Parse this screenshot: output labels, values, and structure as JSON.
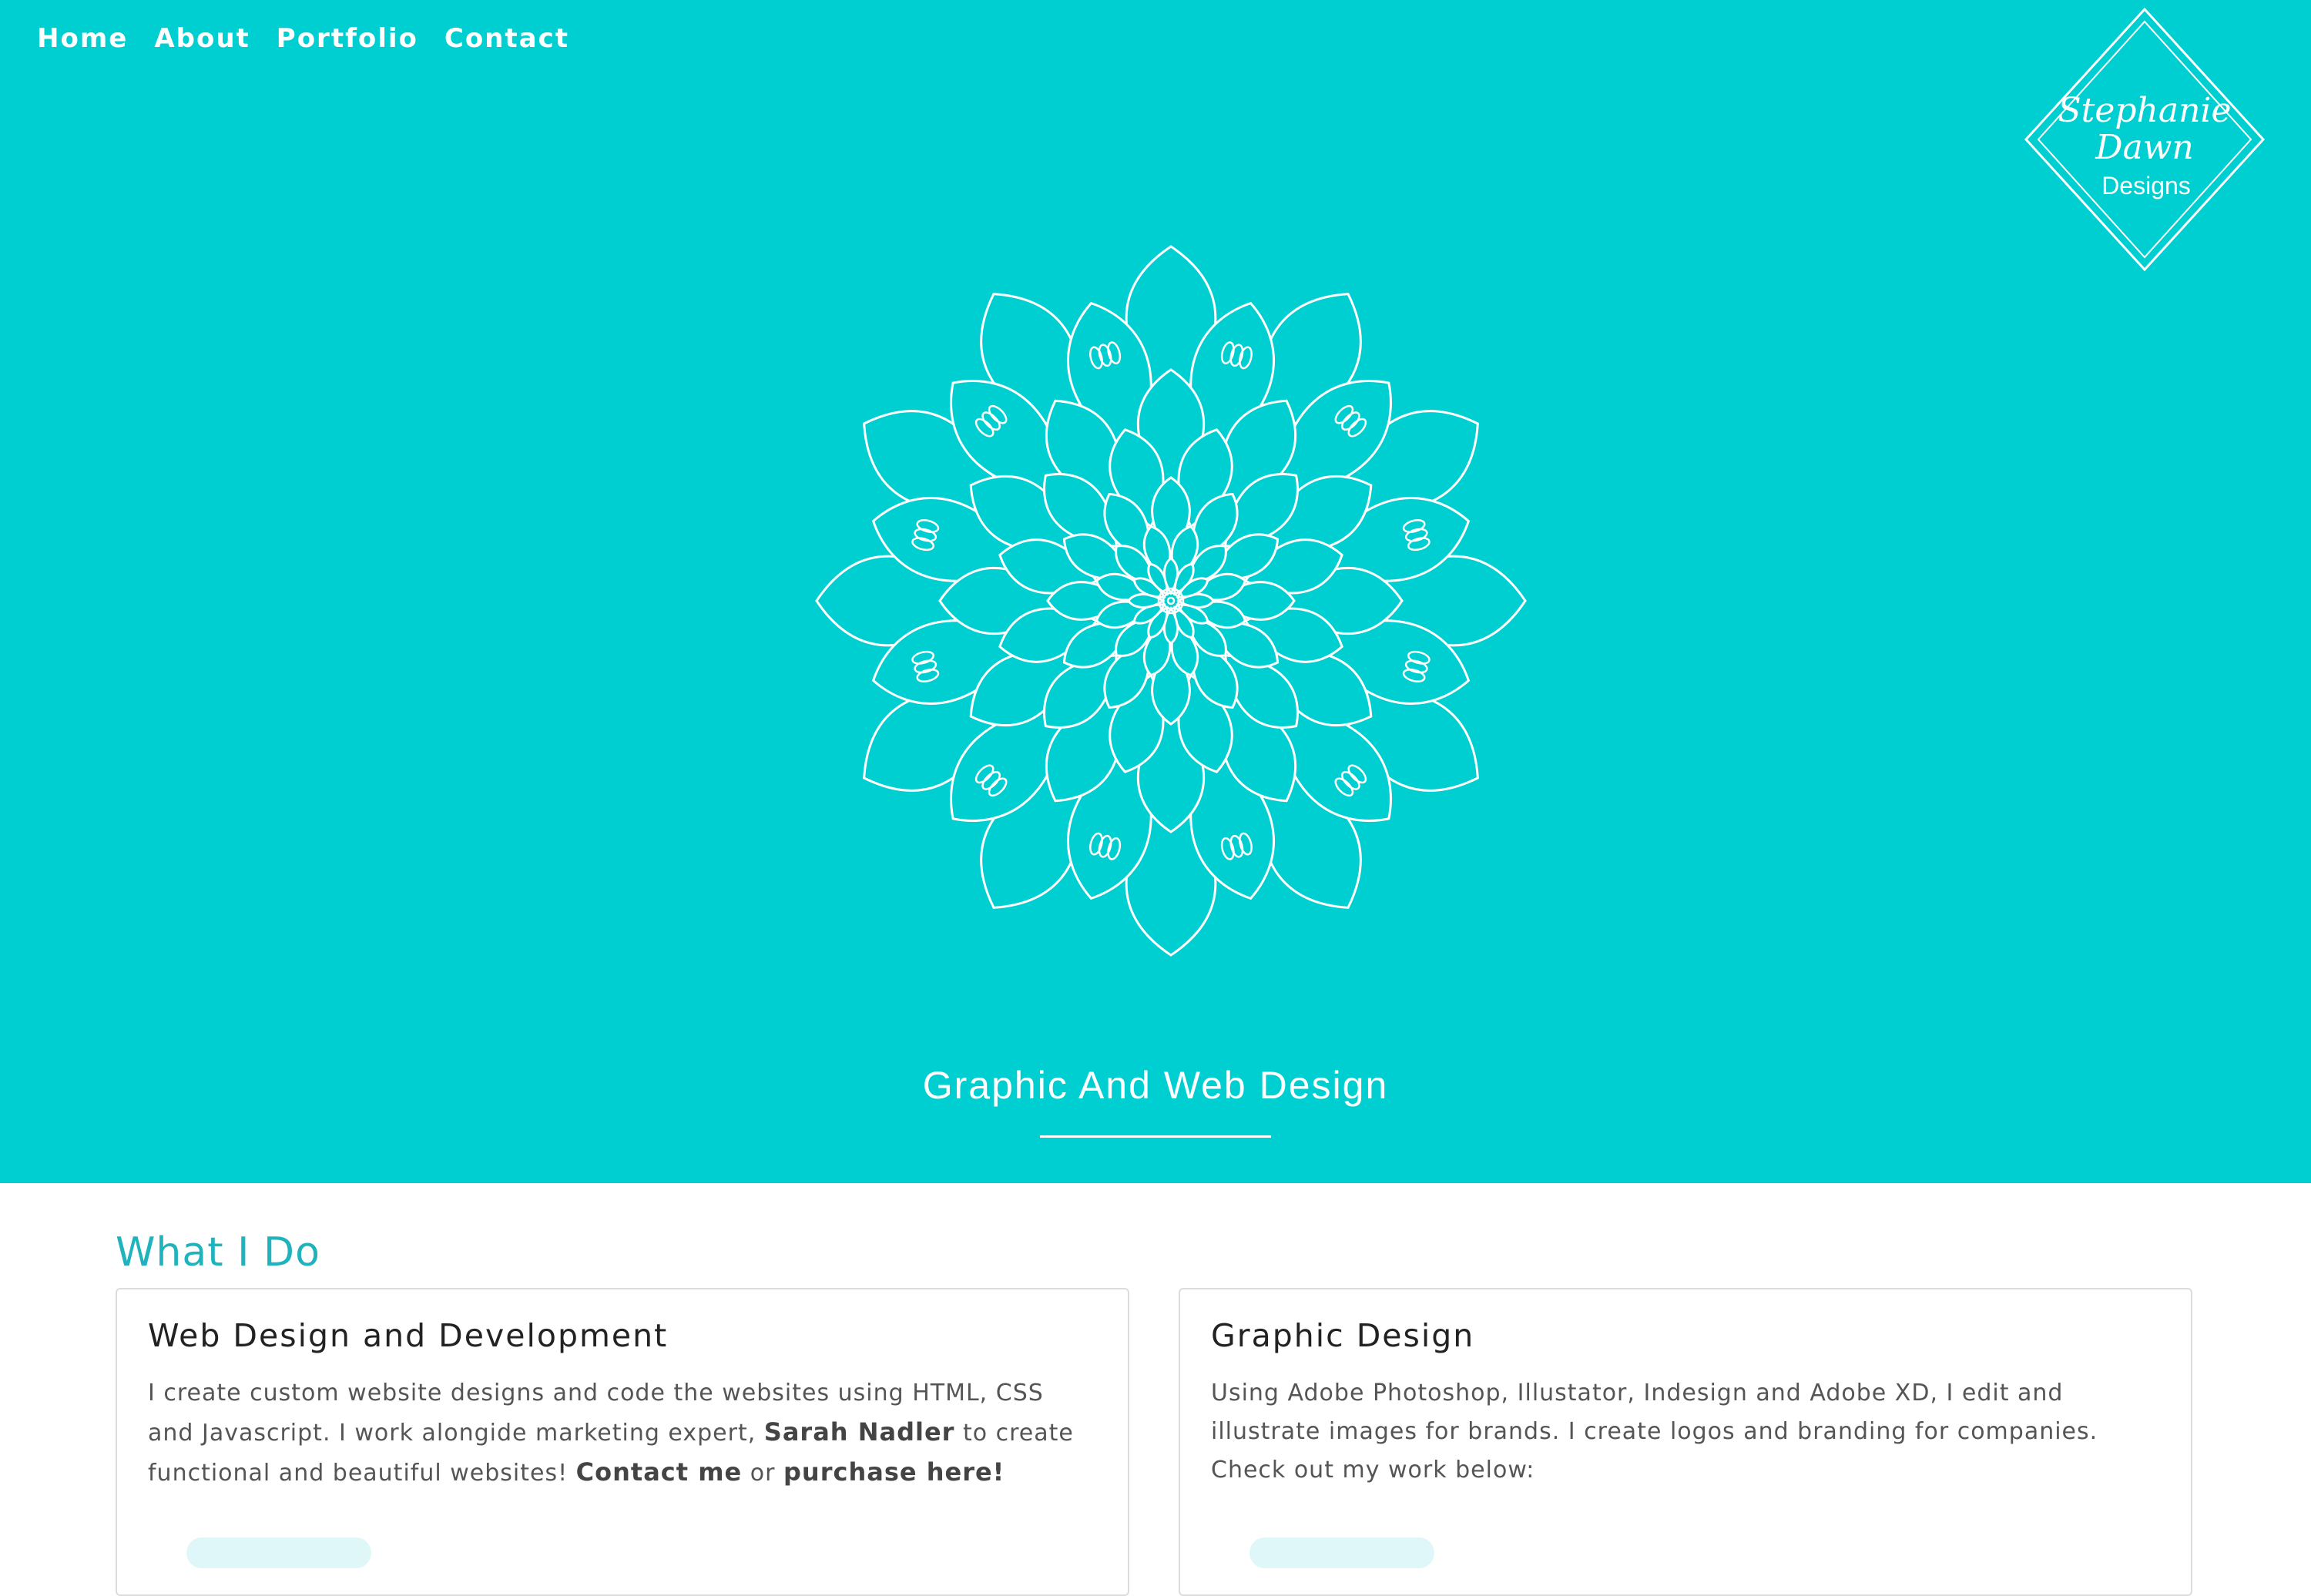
{
  "nav": {
    "items": [
      {
        "label": "Home"
      },
      {
        "label": "About"
      },
      {
        "label": "Portfolio"
      },
      {
        "label": "Contact"
      }
    ]
  },
  "logo": {
    "line1": "Stephanie",
    "line2": "Dawn",
    "line3": "Designs"
  },
  "hero": {
    "background_color": "#00cfd1",
    "illustration": "mandala-flower-icon",
    "tagline": "Graphic And Web Design"
  },
  "section": {
    "title": "What I Do",
    "accent_color": "#1fb3bd"
  },
  "cards": [
    {
      "title": "Web Design and Development",
      "text_a": "I create custom website designs and code the websites using HTML, CSS and Javascript. I work alongide marketing expert, ",
      "link_a": "Sarah Nadler",
      "text_b": " to create functional and beautiful websites! ",
      "link_b": "Contact me",
      "text_c": " or ",
      "link_c": "purchase here!"
    },
    {
      "title": "Graphic Design",
      "line1": "Using Adobe Photoshop, Illustator, Indesign and Adobe XD, I edit and illustrate images for brands. I create logos and branding for companies.",
      "line2": "Check out my work below:"
    }
  ]
}
